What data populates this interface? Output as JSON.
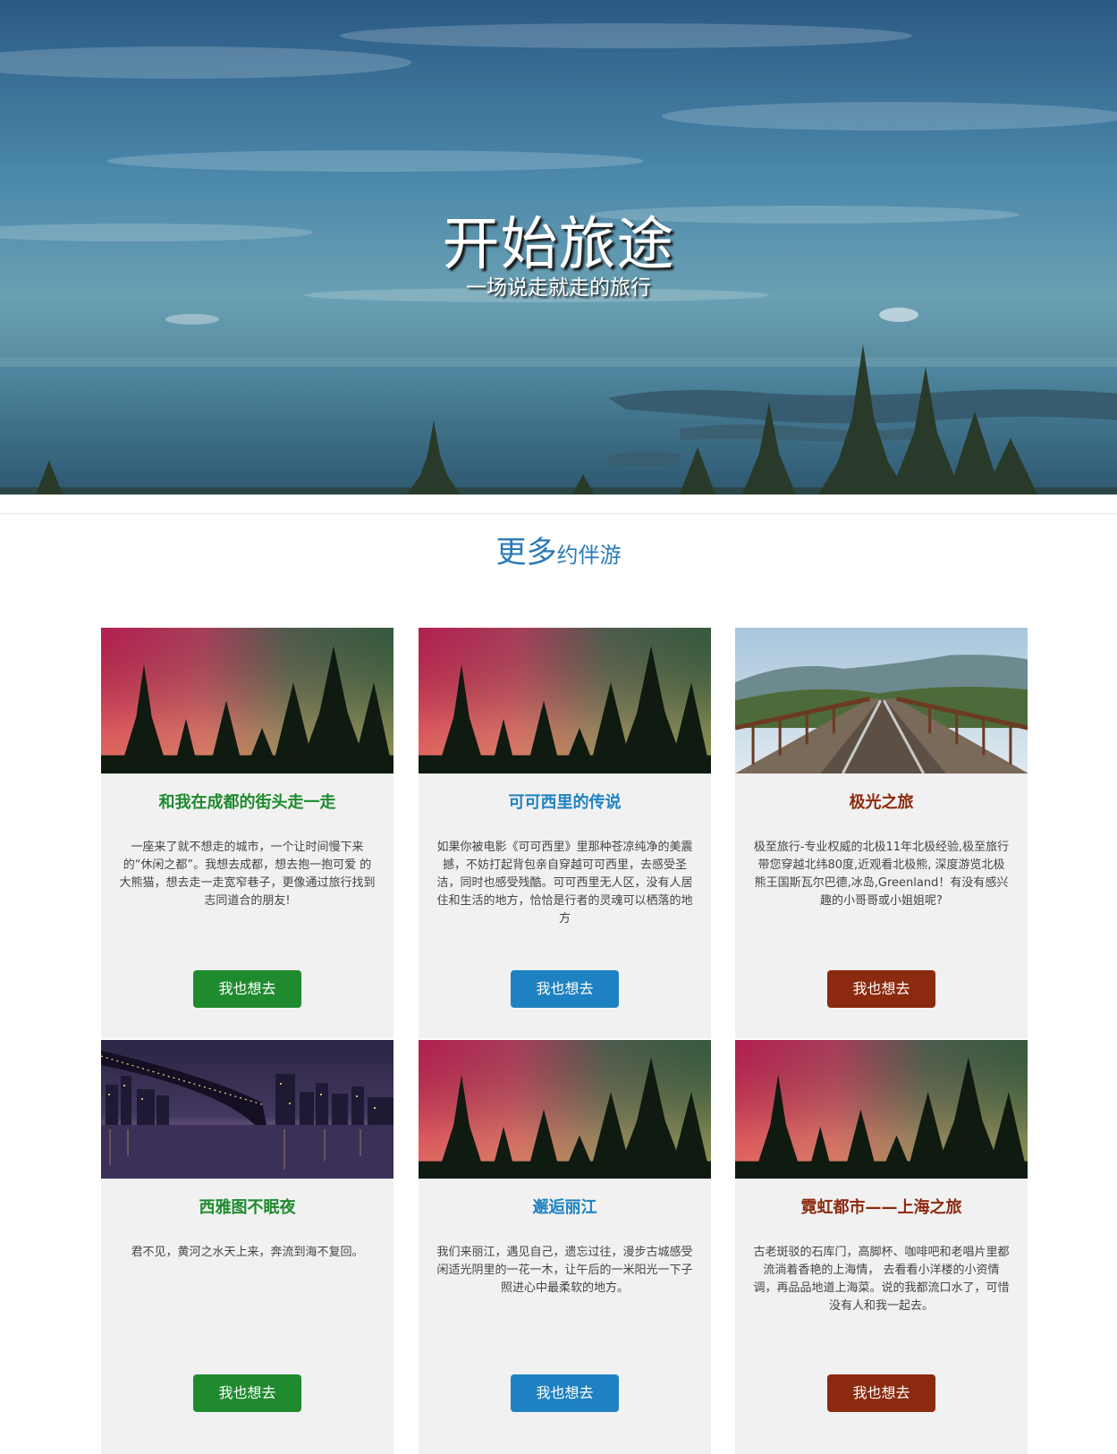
{
  "hero": {
    "title": "开始旅途",
    "subtitle": "一场说走就走的旅行"
  },
  "section": {
    "title_big": "更多",
    "title_small": "约伴游"
  },
  "colors": {
    "green": "#1f8a2e",
    "blue": "#1e82c2",
    "red": "#8c2a0f",
    "section_title": "#2a7ab8",
    "card_bg": "#f1f1f1"
  },
  "cards": [
    {
      "title": "和我在成都的街头走一走",
      "text": "一座来了就不想走的城市，一个让时间慢下来的“休闲之都”。我想去成都，想去抱一抱可爱 的大熊猫，想去走一走宽窄巷子，更像通过旅行找到志同道合的朋友!",
      "button": "我也想去",
      "image": "aurora-forest",
      "accent": "green"
    },
    {
      "title": "可可西里的传说",
      "text": "如果你被电影《可可西里》里那种苍凉纯净的美震撼，不妨打起背包亲自穿越可可西里，去感受圣洁，同时也感受残酷。可可西里无人区，没有人居住和生活的地方，恰恰是行者的灵魂可以栖落的地方",
      "button": "我也想去",
      "image": "aurora-forest",
      "accent": "blue"
    },
    {
      "title": "极光之旅",
      "text": "极至旅行-专业权威的北极11年北极经验,极至旅行带您穿越北纬80度,近观看北极熊, 深度游览北极熊王国斯瓦尔巴德,冰岛,Greenland！有没有感兴趣的小哥哥或小姐姐呢?",
      "button": "我也想去",
      "image": "railway-bridge",
      "accent": "red"
    },
    {
      "title": "西雅图不眠夜",
      "text": "君不见，黄河之水天上来，奔流到海不复回。",
      "button": "我也想去",
      "image": "city-bridge-night",
      "accent": "green"
    },
    {
      "title": "邂逅丽江",
      "text": "我们来丽江，遇见自己，遗忘过往，漫步古城感受闲适光阴里的一花一木，让午后的一米阳光一下子照进心中最柔软的地方。",
      "button": "我也想去",
      "image": "aurora-forest",
      "accent": "blue"
    },
    {
      "title": "霓虹都市——上海之旅",
      "text": "古老斑驳的石库门，高脚杯、咖啡吧和老唱片里都流淌着香艳的上海情， 去看看小洋楼的小资情调，再品品地道上海菜。说的我都流口水了，可惜没有人和我一起去。",
      "button": "我也想去",
      "image": "aurora-forest",
      "accent": "red"
    }
  ]
}
